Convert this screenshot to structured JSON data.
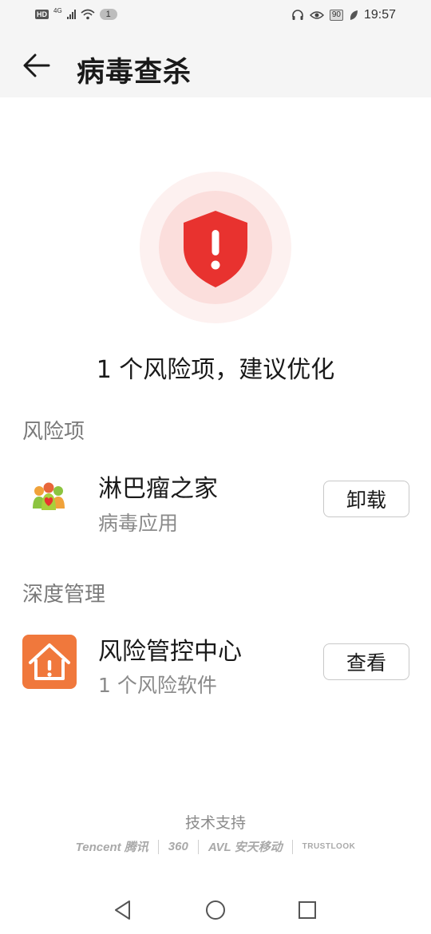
{
  "status_bar": {
    "hd": "HD",
    "network": "4G",
    "notification_count": "1",
    "battery": "90",
    "time": "19:57"
  },
  "header": {
    "title": "病毒查杀"
  },
  "summary": {
    "headline": "1 个风险项，建议优化"
  },
  "risk_section": {
    "title": "风险项",
    "items": [
      {
        "name": "淋巴瘤之家",
        "description": "病毒应用",
        "action": "卸载"
      }
    ]
  },
  "deep_section": {
    "title": "深度管理",
    "items": [
      {
        "name": "风险管控中心",
        "description": "1 个风险软件",
        "action": "查看"
      }
    ]
  },
  "footer": {
    "tech_support": "技术支持",
    "partners": [
      "Tencent 腾讯",
      "360",
      "AVL 安天移动",
      "TRUSTLOOK"
    ]
  },
  "colors": {
    "danger": "#e8322f",
    "orange": "#f0783c",
    "muted": "#8a8a8a"
  }
}
